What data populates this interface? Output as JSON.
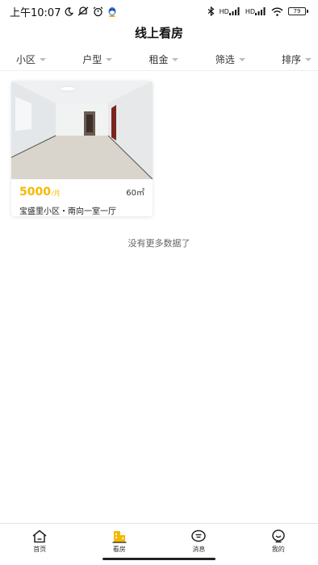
{
  "status_bar": {
    "time": "上午10:07",
    "network_label_1": "HD",
    "network_label_2": "HD",
    "battery": "79"
  },
  "header": {
    "title": "线上看房"
  },
  "filters": [
    {
      "label": "小区"
    },
    {
      "label": "户型"
    },
    {
      "label": "租金"
    },
    {
      "label": "筛选"
    },
    {
      "label": "排序"
    }
  ],
  "listings": [
    {
      "price": "5000",
      "price_unit": "/月",
      "area": "60㎡",
      "title": "宝盛里小区・南向一室一厅"
    }
  ],
  "no_more_text": "没有更多数据了",
  "bottom_nav": [
    {
      "label": "首页",
      "icon": "home-icon",
      "active": false
    },
    {
      "label": "看房",
      "icon": "building-icon",
      "active": true
    },
    {
      "label": "消息",
      "icon": "message-icon",
      "active": false
    },
    {
      "label": "我的",
      "icon": "profile-icon",
      "active": false
    }
  ],
  "colors": {
    "accent": "#f5b800",
    "text": "#222222",
    "divider": "#eeeeee"
  }
}
